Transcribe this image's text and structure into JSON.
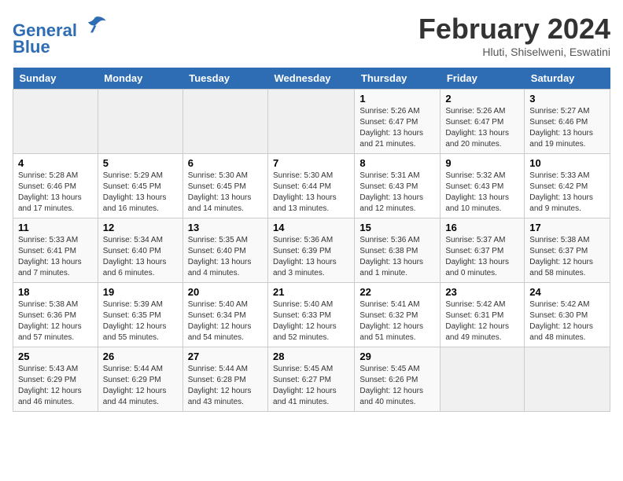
{
  "header": {
    "logo_line1": "General",
    "logo_line2": "Blue",
    "month": "February 2024",
    "location": "Hluti, Shiselweni, Eswatini"
  },
  "days_of_week": [
    "Sunday",
    "Monday",
    "Tuesday",
    "Wednesday",
    "Thursday",
    "Friday",
    "Saturday"
  ],
  "weeks": [
    [
      {
        "day": "",
        "info": ""
      },
      {
        "day": "",
        "info": ""
      },
      {
        "day": "",
        "info": ""
      },
      {
        "day": "",
        "info": ""
      },
      {
        "day": "1",
        "info": "Sunrise: 5:26 AM\nSunset: 6:47 PM\nDaylight: 13 hours and 21 minutes."
      },
      {
        "day": "2",
        "info": "Sunrise: 5:26 AM\nSunset: 6:47 PM\nDaylight: 13 hours and 20 minutes."
      },
      {
        "day": "3",
        "info": "Sunrise: 5:27 AM\nSunset: 6:46 PM\nDaylight: 13 hours and 19 minutes."
      }
    ],
    [
      {
        "day": "4",
        "info": "Sunrise: 5:28 AM\nSunset: 6:46 PM\nDaylight: 13 hours and 17 minutes."
      },
      {
        "day": "5",
        "info": "Sunrise: 5:29 AM\nSunset: 6:45 PM\nDaylight: 13 hours and 16 minutes."
      },
      {
        "day": "6",
        "info": "Sunrise: 5:30 AM\nSunset: 6:45 PM\nDaylight: 13 hours and 14 minutes."
      },
      {
        "day": "7",
        "info": "Sunrise: 5:30 AM\nSunset: 6:44 PM\nDaylight: 13 hours and 13 minutes."
      },
      {
        "day": "8",
        "info": "Sunrise: 5:31 AM\nSunset: 6:43 PM\nDaylight: 13 hours and 12 minutes."
      },
      {
        "day": "9",
        "info": "Sunrise: 5:32 AM\nSunset: 6:43 PM\nDaylight: 13 hours and 10 minutes."
      },
      {
        "day": "10",
        "info": "Sunrise: 5:33 AM\nSunset: 6:42 PM\nDaylight: 13 hours and 9 minutes."
      }
    ],
    [
      {
        "day": "11",
        "info": "Sunrise: 5:33 AM\nSunset: 6:41 PM\nDaylight: 13 hours and 7 minutes."
      },
      {
        "day": "12",
        "info": "Sunrise: 5:34 AM\nSunset: 6:40 PM\nDaylight: 13 hours and 6 minutes."
      },
      {
        "day": "13",
        "info": "Sunrise: 5:35 AM\nSunset: 6:40 PM\nDaylight: 13 hours and 4 minutes."
      },
      {
        "day": "14",
        "info": "Sunrise: 5:36 AM\nSunset: 6:39 PM\nDaylight: 13 hours and 3 minutes."
      },
      {
        "day": "15",
        "info": "Sunrise: 5:36 AM\nSunset: 6:38 PM\nDaylight: 13 hours and 1 minute."
      },
      {
        "day": "16",
        "info": "Sunrise: 5:37 AM\nSunset: 6:37 PM\nDaylight: 13 hours and 0 minutes."
      },
      {
        "day": "17",
        "info": "Sunrise: 5:38 AM\nSunset: 6:37 PM\nDaylight: 12 hours and 58 minutes."
      }
    ],
    [
      {
        "day": "18",
        "info": "Sunrise: 5:38 AM\nSunset: 6:36 PM\nDaylight: 12 hours and 57 minutes."
      },
      {
        "day": "19",
        "info": "Sunrise: 5:39 AM\nSunset: 6:35 PM\nDaylight: 12 hours and 55 minutes."
      },
      {
        "day": "20",
        "info": "Sunrise: 5:40 AM\nSunset: 6:34 PM\nDaylight: 12 hours and 54 minutes."
      },
      {
        "day": "21",
        "info": "Sunrise: 5:40 AM\nSunset: 6:33 PM\nDaylight: 12 hours and 52 minutes."
      },
      {
        "day": "22",
        "info": "Sunrise: 5:41 AM\nSunset: 6:32 PM\nDaylight: 12 hours and 51 minutes."
      },
      {
        "day": "23",
        "info": "Sunrise: 5:42 AM\nSunset: 6:31 PM\nDaylight: 12 hours and 49 minutes."
      },
      {
        "day": "24",
        "info": "Sunrise: 5:42 AM\nSunset: 6:30 PM\nDaylight: 12 hours and 48 minutes."
      }
    ],
    [
      {
        "day": "25",
        "info": "Sunrise: 5:43 AM\nSunset: 6:29 PM\nDaylight: 12 hours and 46 minutes."
      },
      {
        "day": "26",
        "info": "Sunrise: 5:44 AM\nSunset: 6:29 PM\nDaylight: 12 hours and 44 minutes."
      },
      {
        "day": "27",
        "info": "Sunrise: 5:44 AM\nSunset: 6:28 PM\nDaylight: 12 hours and 43 minutes."
      },
      {
        "day": "28",
        "info": "Sunrise: 5:45 AM\nSunset: 6:27 PM\nDaylight: 12 hours and 41 minutes."
      },
      {
        "day": "29",
        "info": "Sunrise: 5:45 AM\nSunset: 6:26 PM\nDaylight: 12 hours and 40 minutes."
      },
      {
        "day": "",
        "info": ""
      },
      {
        "day": "",
        "info": ""
      }
    ]
  ]
}
